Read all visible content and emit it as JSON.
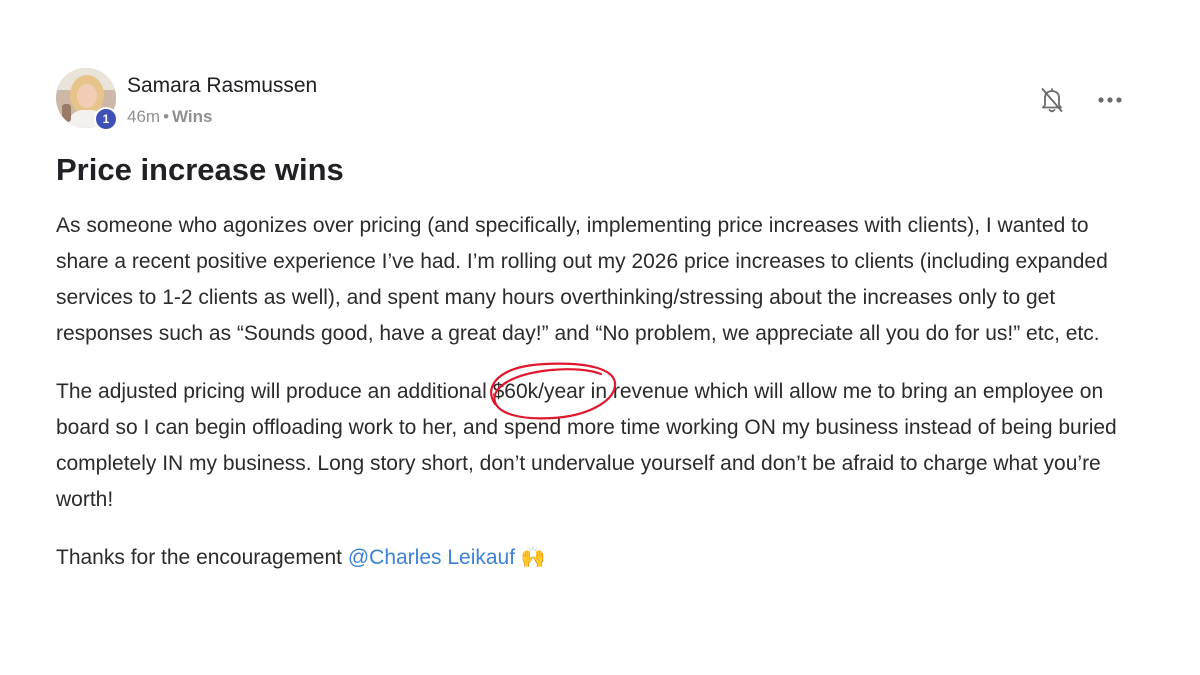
{
  "post": {
    "author": {
      "name": "Samara Rasmussen",
      "level": "1"
    },
    "meta": {
      "time": "46m",
      "separator": "•",
      "category": "Wins"
    },
    "title": "Price increase wins",
    "paragraph1": "As someone who agonizes over pricing (and specifically, implementing price increases with clients), I wanted to share a recent positive experience I’ve had. I’m rolling out my 2026 price increases to clients (including expanded services to 1-2 clients as well), and spent many hours overthinking/stressing about the increases only to get responses such as “Sounds good, have a great day!” and “No problem, we appreciate all you do for us!” etc, etc.",
    "paragraph2": {
      "before": "The adjusted pricing will produce an additional ",
      "highlight": "$60k/year",
      "after": " in revenue which will allow me to bring an employee on board so I can begin offloading work to her, and spend more time working ON my business instead of being buried completely IN my business. Long story short, don’t undervalue yourself and don’t be afraid to charge what you’re worth!"
    },
    "paragraph3": {
      "text": "Thanks for the encouragement ",
      "mention": "@Charles Leikauf",
      "emoji": "🙌"
    },
    "icons": {
      "notification": "bell-off-icon",
      "more": "more-horizontal-icon"
    },
    "colors": {
      "badge": "#3f51b5",
      "mention": "#3b82d6",
      "annotation": "#e0182d"
    }
  }
}
